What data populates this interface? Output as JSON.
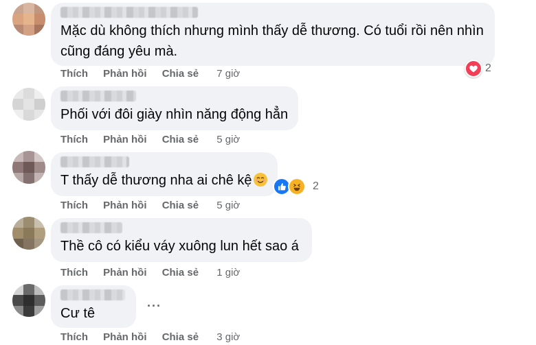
{
  "actions": {
    "like": "Thích",
    "reply": "Phản hồi",
    "share": "Chia sẻ"
  },
  "comments": [
    {
      "text": "Mặc dù không thích nhưng mình thấy dễ thương. Có tuổi rồi nên nhìn cũng đáng yêu mà.",
      "time": "7 giờ",
      "reactions": {
        "icons": [
          "heart-icon"
        ],
        "count": "2"
      }
    },
    {
      "text": "Phối với đôi giày nhìn năng động hẳn",
      "time": "5 giờ"
    },
    {
      "text": "T thấy dễ thương nha ai chê kệ",
      "inline_emoji": "smiling-face-icon",
      "time": "5 giờ",
      "reactions": {
        "icons": [
          "like-icon",
          "haha-icon"
        ],
        "count": "2"
      }
    },
    {
      "text": "Thề cô có kiểu váy xuông lun hết sao á",
      "time": "1 giờ"
    },
    {
      "text": "Cư tê",
      "time": "3 giờ",
      "more": "···"
    }
  ],
  "colors": {
    "bubble": "#f0f2f5",
    "action_text": "#65676b",
    "heart": "#f33e58",
    "like": "#1877f2",
    "haha": "#f7b125"
  }
}
